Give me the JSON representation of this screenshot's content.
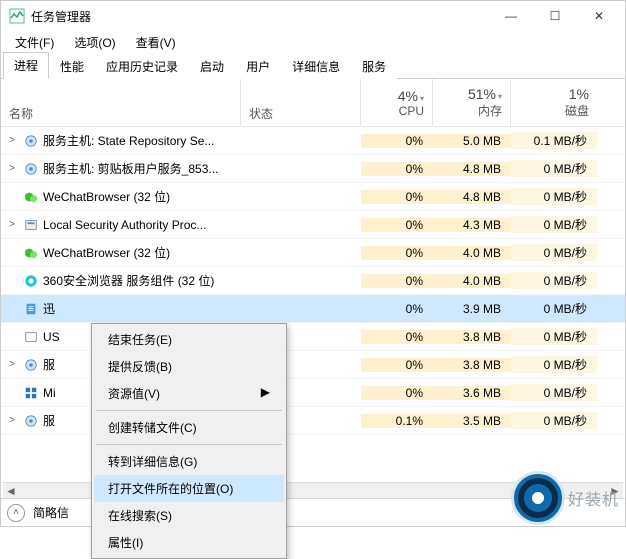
{
  "window": {
    "title": "任务管理器",
    "min": "—",
    "max": "☐",
    "close": "✕"
  },
  "menu": {
    "file": "文件(F)",
    "options": "选项(O)",
    "view": "查看(V)"
  },
  "tabs": [
    "进程",
    "性能",
    "应用历史记录",
    "启动",
    "用户",
    "详细信息",
    "服务"
  ],
  "columns": {
    "name": "名称",
    "status": "状态",
    "cpu_pct": "4%",
    "cpu_lbl": "CPU",
    "mem_pct": "51%",
    "mem_lbl": "内存",
    "disk_pct": "1%",
    "disk_lbl": "磁盘"
  },
  "rows": [
    {
      "exp": ">",
      "icon": "gear",
      "name": "服务主机: State Repository Se...",
      "cpu": "0%",
      "mem": "5.0 MB",
      "disk": "0.1 MB/秒"
    },
    {
      "exp": ">",
      "icon": "gear",
      "name": "服务主机: 剪贴板用户服务_853...",
      "cpu": "0%",
      "mem": "4.8 MB",
      "disk": "0 MB/秒"
    },
    {
      "exp": "",
      "icon": "wechat",
      "name": "WeChatBrowser (32 位)",
      "cpu": "0%",
      "mem": "4.8 MB",
      "disk": "0 MB/秒"
    },
    {
      "exp": ">",
      "icon": "shield",
      "name": "Local Security Authority Proc...",
      "cpu": "0%",
      "mem": "4.3 MB",
      "disk": "0 MB/秒"
    },
    {
      "exp": "",
      "icon": "wechat",
      "name": "WeChatBrowser (32 位)",
      "cpu": "0%",
      "mem": "4.0 MB",
      "disk": "0 MB/秒"
    },
    {
      "exp": "",
      "icon": "360",
      "name": "360安全浏览器 服务组件 (32 位)",
      "cpu": "0%",
      "mem": "4.0 MB",
      "disk": "0 MB/秒"
    },
    {
      "exp": "",
      "icon": "doc",
      "name": "迅",
      "cpu": "0%",
      "mem": "3.9 MB",
      "disk": "0 MB/秒",
      "selected": true
    },
    {
      "exp": "",
      "icon": "box",
      "name": "US",
      "cpu": "0%",
      "mem": "3.8 MB",
      "disk": "0 MB/秒"
    },
    {
      "exp": ">",
      "icon": "gear",
      "name": "服",
      "cpu": "0%",
      "mem": "3.8 MB",
      "disk": "0 MB/秒"
    },
    {
      "exp": "",
      "icon": "win",
      "name": "Mi",
      "cpu": "0%",
      "mem": "3.6 MB",
      "disk": "0 MB/秒"
    },
    {
      "exp": ">",
      "icon": "gear",
      "name": "服",
      "cpu": "0.1%",
      "mem": "3.5 MB",
      "disk": "0 MB/秒"
    }
  ],
  "context_menu": {
    "end_task": "结束任务(E)",
    "feedback": "提供反馈(B)",
    "resource": "资源值(V)",
    "create_dump": "创建转储文件(C)",
    "goto_details": "转到详细信息(G)",
    "open_location": "打开文件所在的位置(O)",
    "search_online": "在线搜索(S)",
    "properties": "属性(I)"
  },
  "bottom": {
    "fewer_label": "简略信"
  },
  "watermark": {
    "text": "好装机"
  }
}
